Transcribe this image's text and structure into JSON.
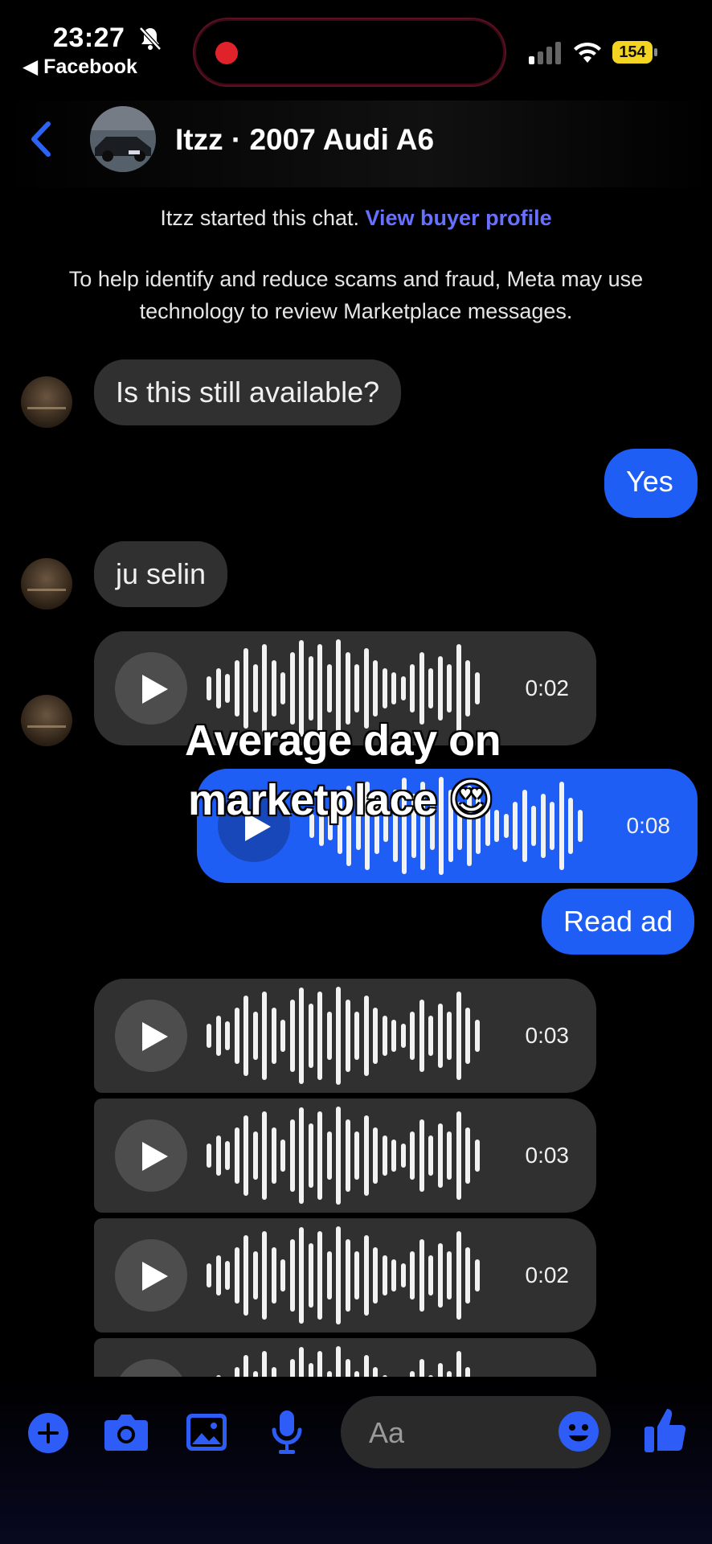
{
  "status_bar": {
    "time": "23:27",
    "back_app": "◀ Facebook",
    "battery": "154"
  },
  "header": {
    "title": "Itzz · 2007 Audi A6"
  },
  "intro": {
    "started_text": "Itzz started this chat.",
    "profile_link": "View buyer profile",
    "notice": "To help identify and reduce scams and fraud, Meta may use",
    "notice_line2": "technology to review Marketplace messages."
  },
  "messages": {
    "m1": "Is this still available?",
    "m2": "Yes",
    "m3": "ju selin",
    "v1_duration": "0:02",
    "v2_duration": "0:08",
    "m4": "Read ad",
    "v3_duration": "0:03",
    "v4_duration": "0:03",
    "v5_duration": "0:02"
  },
  "overlay": {
    "line1": "Average day on",
    "line2": "marketplace 😍"
  },
  "composer": {
    "placeholder": "Aa"
  },
  "colors": {
    "accent": "#1f5ef5",
    "link": "#6770ff",
    "incoming_bubble": "#303030"
  }
}
